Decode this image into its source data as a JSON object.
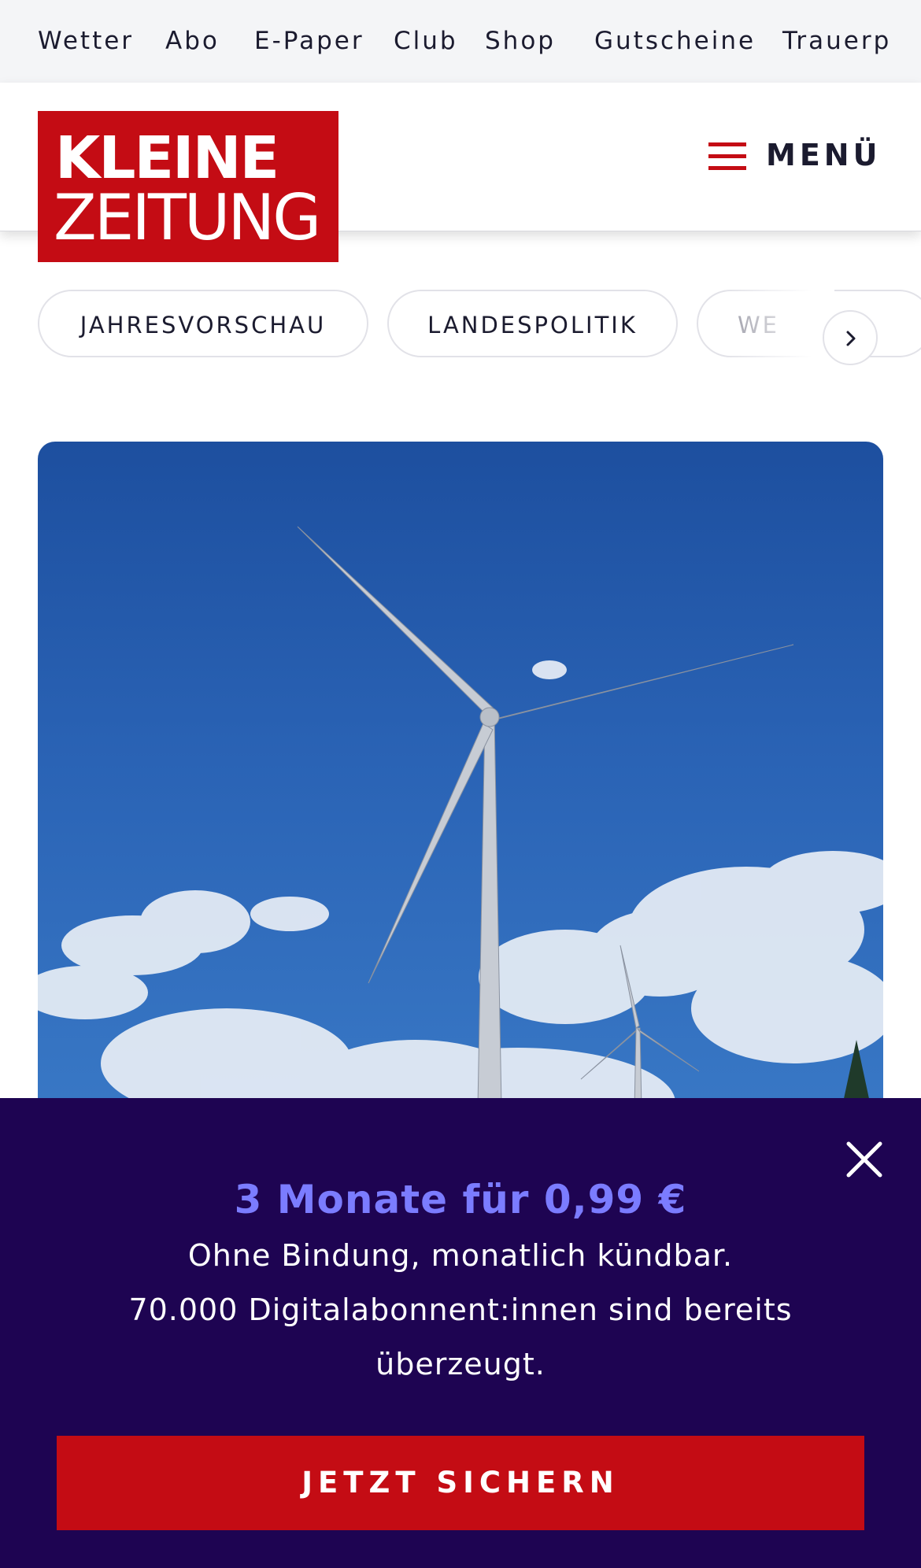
{
  "topnav": {
    "items": [
      "Wetter",
      "Abo",
      "E-Paper",
      "Club",
      "Shop",
      "Gutscheine",
      "Trauerp"
    ]
  },
  "logo": {
    "line1": "KLEINE",
    "line2": "ZEITUNG"
  },
  "header": {
    "menu_label": "MENÜ",
    "menu_icon": "hamburger-icon"
  },
  "chips": {
    "items": [
      "JAHRESVORSCHAU",
      "LANDESPOLITIK",
      "WE"
    ],
    "next_icon": "chevron-right-icon"
  },
  "hero": {
    "image": "wind-turbines-photo"
  },
  "offer": {
    "title": "3 Monate für 0,99 €",
    "line1": "Ohne Bindung, monatlich kündbar.",
    "line2": "70.000 Digitalabonnent:innen sind bereits",
    "line3": "überzeugt.",
    "cta_label": "JETZT SICHERN",
    "close_icon": "close-icon"
  },
  "colors": {
    "brand_red": "#c40c14",
    "offer_bg": "#1e0452",
    "offer_accent": "#7b7cff"
  }
}
